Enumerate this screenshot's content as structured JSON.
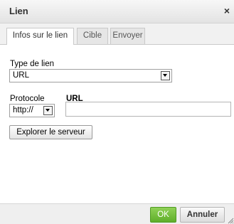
{
  "dialog": {
    "title": "Lien",
    "close_label": "×"
  },
  "tabs": [
    {
      "label": "Infos sur le lien",
      "active": true
    },
    {
      "label": "Cible",
      "active": false
    },
    {
      "label": "Envoyer",
      "active": false
    }
  ],
  "link_type": {
    "label": "Type de lien",
    "value": "URL"
  },
  "protocol": {
    "label": "Protocole",
    "value": "http://"
  },
  "url": {
    "label": "URL",
    "value": ""
  },
  "browse_button": "Explorer le serveur",
  "footer": {
    "ok_label": "OK",
    "cancel_label": "Annuler"
  },
  "colors": {
    "ok_green": "#6bbf35",
    "title_bg": "#e9e9e9"
  }
}
